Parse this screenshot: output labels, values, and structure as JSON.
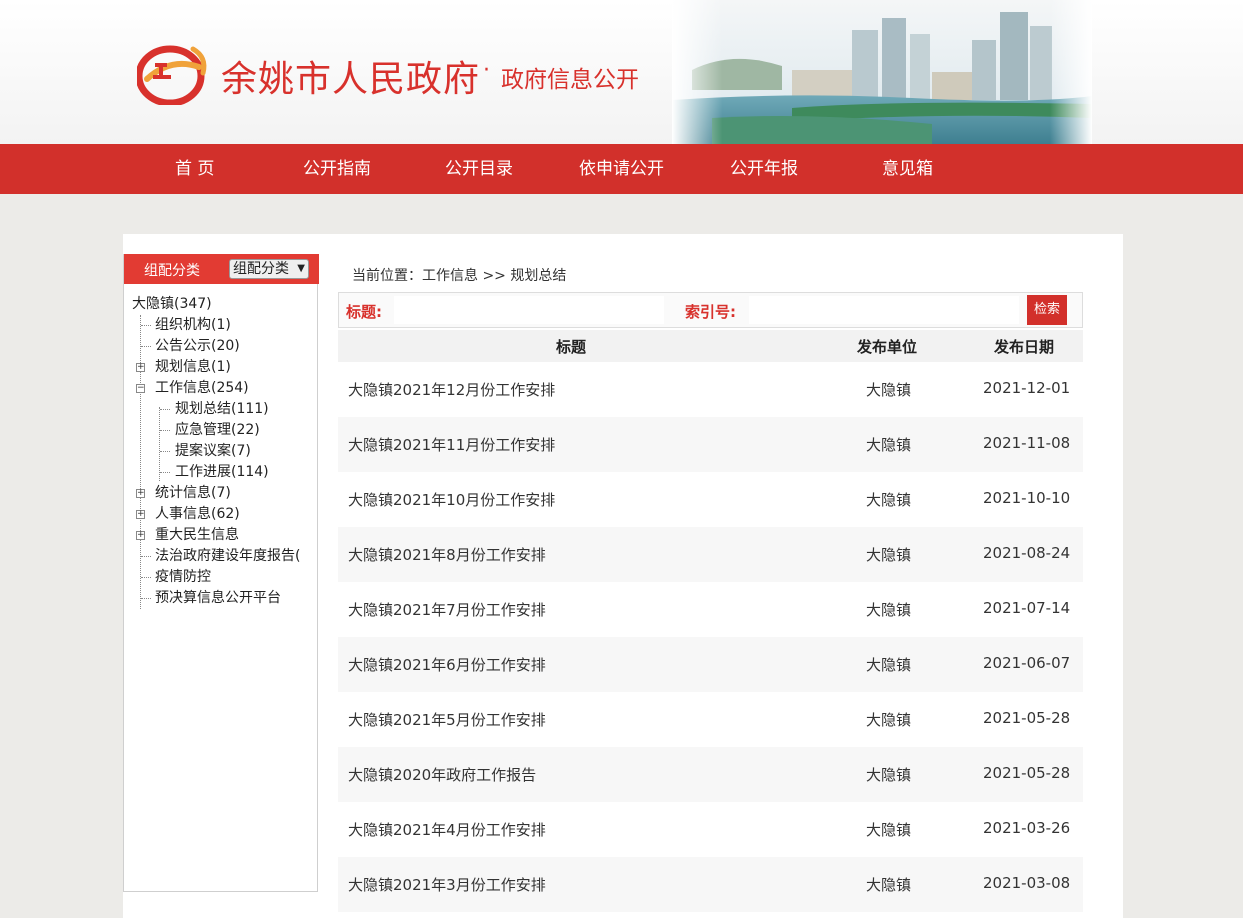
{
  "header": {
    "site_title": "余姚市人民政府",
    "site_dot": "·",
    "site_subtitle": "政府信息公开"
  },
  "nav": [
    {
      "label": "首 页"
    },
    {
      "label": "公开指南"
    },
    {
      "label": "公开目录"
    },
    {
      "label": "依申请公开"
    },
    {
      "label": "公开年报"
    },
    {
      "label": "意见箱"
    }
  ],
  "sidebar": {
    "header_label": "组配分类",
    "select_value": "组配分类",
    "tree": [
      {
        "label": "大隐镇(347)"
      },
      {
        "label": "组织机构(1)"
      },
      {
        "label": "公告公示(20)"
      },
      {
        "label": "规划信息(1)"
      },
      {
        "label": "工作信息(254)"
      },
      {
        "label": "规划总结(111)"
      },
      {
        "label": "应急管理(22)"
      },
      {
        "label": "提案议案(7)"
      },
      {
        "label": "工作进展(114)"
      },
      {
        "label": "统计信息(7)"
      },
      {
        "label": "人事信息(62)"
      },
      {
        "label": "重大民生信息"
      },
      {
        "label": "法治政府建设年度报告("
      },
      {
        "label": "疫情防控"
      },
      {
        "label": "预决算信息公开平台"
      }
    ]
  },
  "breadcrumb": "当前位置：工作信息 >> 规划总结",
  "search": {
    "title_label": "标题:",
    "title_value": "",
    "index_label": "索引号:",
    "index_value": "",
    "button_label": "检索"
  },
  "table": {
    "headers": {
      "title": "标题",
      "unit": "发布单位",
      "date": "发布日期"
    },
    "rows": [
      {
        "title": "大隐镇2021年12月份工作安排",
        "unit": "大隐镇",
        "date": "2021-12-01"
      },
      {
        "title": "大隐镇2021年11月份工作安排",
        "unit": "大隐镇",
        "date": "2021-11-08"
      },
      {
        "title": "大隐镇2021年10月份工作安排",
        "unit": "大隐镇",
        "date": "2021-10-10"
      },
      {
        "title": "大隐镇2021年8月份工作安排",
        "unit": "大隐镇",
        "date": "2021-08-24"
      },
      {
        "title": "大隐镇2021年7月份工作安排",
        "unit": "大隐镇",
        "date": "2021-07-14"
      },
      {
        "title": "大隐镇2021年6月份工作安排",
        "unit": "大隐镇",
        "date": "2021-06-07"
      },
      {
        "title": "大隐镇2021年5月份工作安排",
        "unit": "大隐镇",
        "date": "2021-05-28"
      },
      {
        "title": "大隐镇2020年政府工作报告",
        "unit": "大隐镇",
        "date": "2021-05-28"
      },
      {
        "title": "大隐镇2021年4月份工作安排",
        "unit": "大隐镇",
        "date": "2021-03-26"
      },
      {
        "title": "大隐镇2021年3月份工作安排",
        "unit": "大隐镇",
        "date": "2021-03-08"
      }
    ]
  },
  "colors": {
    "brand_red": "#d2302b",
    "sidebar_red": "#e23b33"
  }
}
